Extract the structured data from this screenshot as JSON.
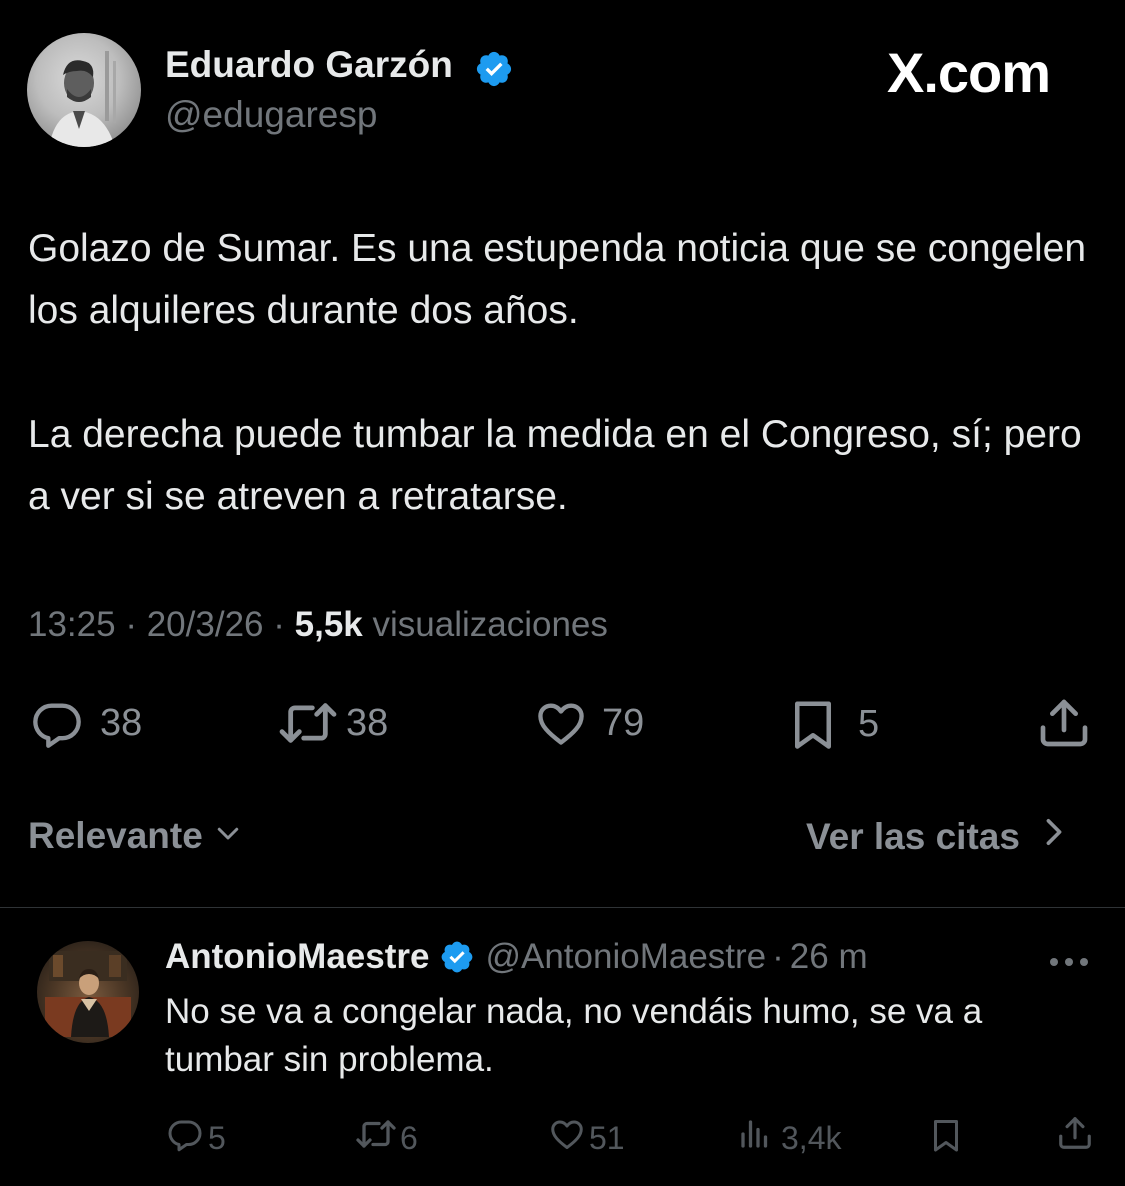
{
  "brand": "X.com",
  "tweet": {
    "author_name": "Eduardo Garzón",
    "author_handle": "@edugaresp",
    "verified": true,
    "paragraph1": "Golazo de Sumar. Es una estupenda noticia que se congelen los alquileres durante dos años.",
    "paragraph2": "La derecha puede tumbar la medida en el Congreso, sí; pero a ver si se atreven a retratarse.",
    "time": "13:25",
    "date": "20/3/26",
    "views": "5,5k",
    "views_label": "visualizaciones",
    "separator": "·",
    "actions": {
      "replies": "38",
      "reposts": "38",
      "likes": "79",
      "bookmarks": "5"
    }
  },
  "filters": {
    "sort_label": "Relevante",
    "quotes_label": "Ver las citas"
  },
  "reply": {
    "author_name": "AntonioMaestre",
    "author_handle": "@AntonioMaestre",
    "time_ago": "26 m",
    "separator": "·",
    "verified": true,
    "text": "No se va a congelar nada, no vendáis humo, se va a tumbar sin problema.",
    "actions": {
      "replies": "5",
      "reposts": "6",
      "likes": "51",
      "views": "3,4k"
    }
  },
  "colors": {
    "background": "#000000",
    "text": "#e7e9ea",
    "secondary": "#71767b",
    "verified": "#1d9bf0"
  },
  "icons": [
    "reply-icon",
    "repost-icon",
    "like-icon",
    "bookmark-icon",
    "share-icon",
    "verified-badge-icon",
    "chevron-down-icon",
    "chevron-right-icon",
    "more-icon",
    "views-icon"
  ]
}
